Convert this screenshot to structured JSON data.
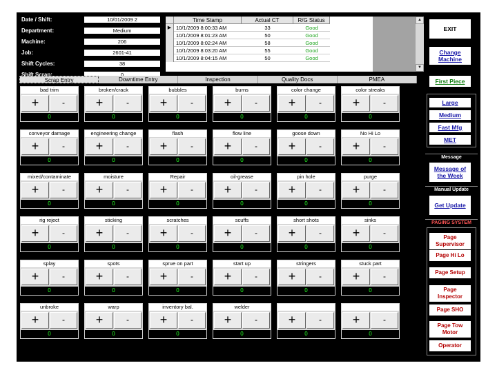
{
  "info": [
    {
      "label": "Date / Shift:",
      "value": "10/01/2009   2"
    },
    {
      "label": "Department:",
      "value": "Medium"
    },
    {
      "label": "Machine:",
      "value": "206"
    },
    {
      "label": "Job:",
      "value": "2601-41"
    },
    {
      "label": "Shift Cycles:",
      "value": "38"
    },
    {
      "label": "Shift Scrap:",
      "value": "0"
    }
  ],
  "log": {
    "headers": [
      "Time Stamp",
      "Actual CT",
      "R/G Status"
    ],
    "selected_marker": "▶",
    "rows": [
      {
        "time": "10/1/2009 8:00:33 AM",
        "ct": "33",
        "status": "Good"
      },
      {
        "time": "10/1/2009 8:01:23 AM",
        "ct": "50",
        "status": "Good"
      },
      {
        "time": "10/1/2009 8:02:24 AM",
        "ct": "58",
        "status": "Good"
      },
      {
        "time": "10/1/2009 8:03:20 AM",
        "ct": "55",
        "status": "Good"
      },
      {
        "time": "10/1/2009 8:04:15 AM",
        "ct": "50",
        "status": "Good"
      }
    ]
  },
  "tabs": [
    "Scrap Entry",
    "Downtime Entry",
    "Inspection",
    "Quality Docs",
    "PMEA"
  ],
  "buttons": {
    "plus": "+",
    "minus": "-"
  },
  "defects": [
    [
      "bad trim",
      "broken/crack",
      "bubbles",
      "burns",
      "color change",
      "color streaks"
    ],
    [
      "conveyor damage",
      "engineering change",
      "flash",
      "flow line",
      "goose down",
      "No Hi Lo"
    ],
    [
      "mixed/contaminate",
      "moisture",
      "Repair",
      "oil-grease",
      "pin hole",
      "purge"
    ],
    [
      "rig reject",
      "sticking",
      "scratches",
      "scuffs",
      "short shots",
      "sinks"
    ],
    [
      "splay",
      "spots",
      "sprue on part",
      "start up",
      "stringers",
      "stuck part"
    ],
    [
      "unbroke",
      "warp",
      "inventory bal.",
      "welder",
      "",
      ""
    ]
  ],
  "count_value": "0",
  "right": {
    "exit": "EXIT",
    "change_machine": "Change\nMachine",
    "first_piece": "First Piece",
    "large": "Large",
    "medium": "Medium",
    "fast_mfg": "Fast Mfg",
    "met": "MET",
    "message_header": "Message",
    "message_of_week": "Message of\nthe Week",
    "manual_update_header": "Manual Update",
    "get_update": "Get Update",
    "paging_header": "PAGING SYSTEM",
    "paging": [
      "Page\nSupervisor",
      "Page Hi Lo",
      "Page Setup",
      "Page\nInspector",
      "Page SHO",
      "Page Tow\nMotor",
      "Operator"
    ]
  },
  "colors": {
    "count_text": "#22ff22",
    "status_good": "#1aa31a",
    "link_blue": "#1818a8",
    "page_red": "#b40000"
  }
}
